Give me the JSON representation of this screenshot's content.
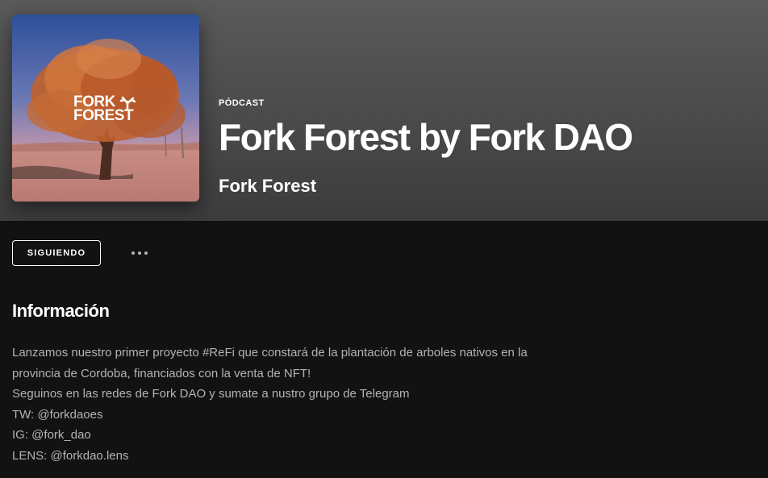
{
  "header": {
    "type_label": "PÓDCAST",
    "title": "Fork Forest by Fork DAO",
    "publisher": "Fork Forest",
    "cover_logo_text": [
      "FORK",
      "FOREST"
    ]
  },
  "actions": {
    "follow_label": "SIGUIENDO",
    "more_icon": "more-horizontal-icon"
  },
  "info": {
    "heading": "Información",
    "lines": [
      "Lanzamos nuestro primer proyecto #ReFi que constará de la plantación de arboles nativos en la",
      "provincia de Cordoba, financiados con la venta de NFT!",
      "Seguinos en las redes de Fork DAO y sumate a nustro grupo de Telegram",
      "TW: @forkdaoes",
      "IG: @fork_dao",
      "LENS: @forkdao.lens"
    ]
  },
  "colors": {
    "background": "#121212",
    "header_gradient_top": "#5a5a5a",
    "text_primary": "#ffffff",
    "text_secondary": "#b3b3b3"
  }
}
